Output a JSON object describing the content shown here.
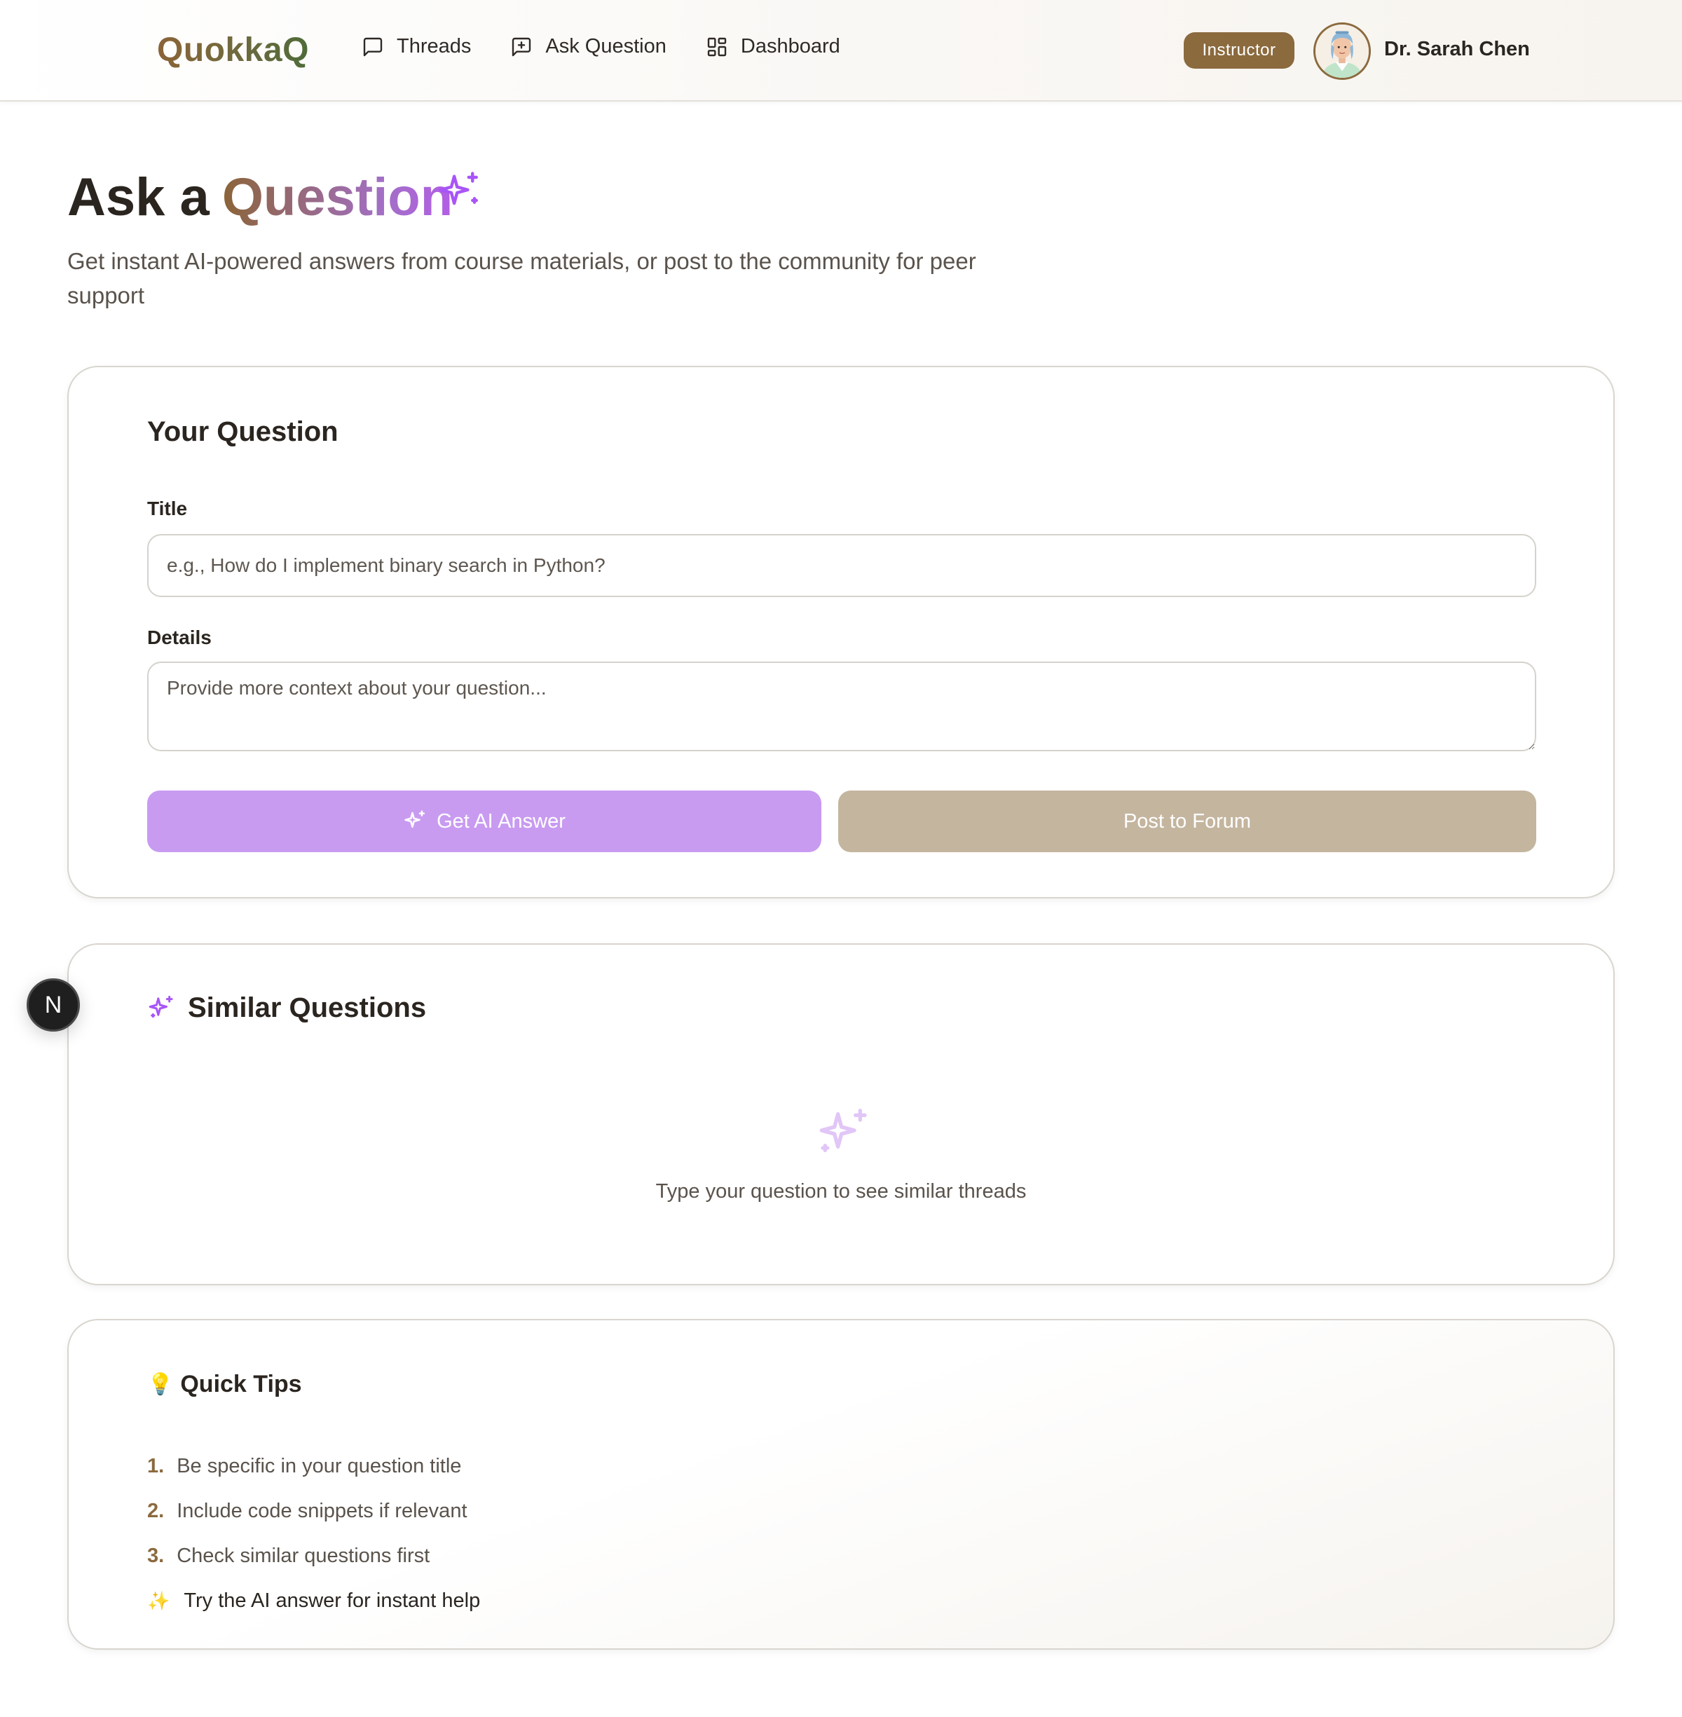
{
  "header": {
    "logo": "QuokkaQ",
    "nav": [
      {
        "label": "Threads",
        "icon": "message-square-icon"
      },
      {
        "label": "Ask Question",
        "icon": "message-plus-icon"
      },
      {
        "label": "Dashboard",
        "icon": "layout-grid-icon"
      }
    ],
    "role_badge": "Instructor",
    "user_name": "Dr. Sarah Chen"
  },
  "page": {
    "title_prefix": "Ask a",
    "title_accent": "Question",
    "subtitle": "Get instant AI-powered answers from course materials, or post to the community for peer support"
  },
  "question_card": {
    "heading": "Your Question",
    "title_label": "Title",
    "title_placeholder": "e.g., How do I implement binary search in Python?",
    "title_value": "",
    "details_label": "Details",
    "details_placeholder": "Provide more context about your question...",
    "details_value": "",
    "ai_button": "Get AI Answer",
    "forum_button": "Post to Forum"
  },
  "similar_card": {
    "heading": "Similar Questions",
    "empty_text": "Type your question to see similar threads"
  },
  "tips_card": {
    "heading": "Quick Tips",
    "tips": [
      {
        "num": "1.",
        "text": "Be specific in your question title"
      },
      {
        "num": "2.",
        "text": "Include code snippets if relevant"
      },
      {
        "num": "3.",
        "text": "Check similar questions first"
      }
    ],
    "ai_tip": "Try the AI answer for instant help"
  },
  "floating_badge": "N",
  "colors": {
    "brand_brown": "#8b6a3e",
    "ai_purple": "#c89bf1",
    "accent_purple": "#a855f7",
    "forum_tan": "#c4b59f"
  }
}
